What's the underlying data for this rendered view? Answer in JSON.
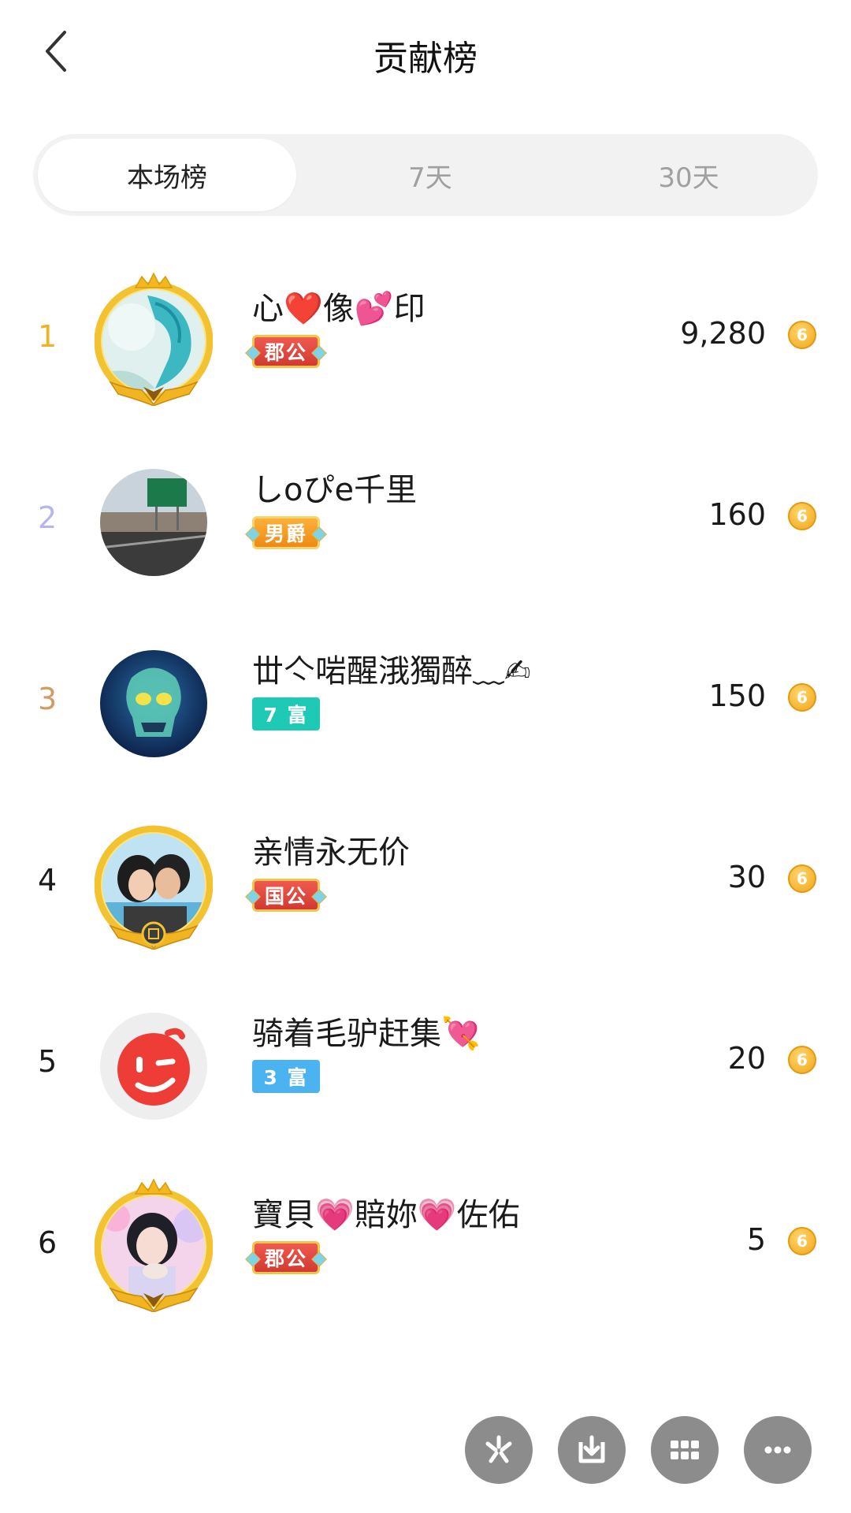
{
  "header": {
    "title": "贡献榜",
    "back_icon": "chevron-left-icon"
  },
  "tabs": [
    {
      "label": "本场榜",
      "active": true
    },
    {
      "label": "7天",
      "active": false
    },
    {
      "label": "30天",
      "active": false
    }
  ],
  "colors": {
    "rank1": "#f0b21e",
    "rank2": "#b7b6ea",
    "rank3": "#d39a63",
    "rank_other": "#1a1a1a",
    "coin": "#f1a61b"
  },
  "ranking": [
    {
      "rank": "1",
      "name": "心❤️像💕印",
      "badge": "郡公",
      "badge_style": "red",
      "score": "9,280",
      "avatar": "dragon-avatar"
    },
    {
      "rank": "2",
      "name": "しoぴe千里",
      "badge": "男爵",
      "badge_style": "orange",
      "score": "160",
      "avatar": "road-sign-avatar"
    },
    {
      "rank": "3",
      "name": "丗亽啱醒涐獨醉﹏✍",
      "badge": "7 富",
      "badge_style": "teal",
      "score": "150",
      "avatar": "skull-avatar"
    },
    {
      "rank": "4",
      "name": "亲情永无价",
      "badge": "国公",
      "badge_style": "red",
      "score": "30",
      "avatar": "couple-avatar"
    },
    {
      "rank": "5",
      "name": "骑着毛驴赶集💘",
      "badge": "3 富",
      "badge_style": "blue",
      "score": "20",
      "avatar": "wink-face-avatar"
    },
    {
      "rank": "6",
      "name": "寶貝💗賠妳💗佐佑",
      "badge": "郡公",
      "badge_style": "red",
      "score": "5",
      "avatar": "girl-avatar"
    }
  ],
  "coin_glyph": "6",
  "bottom_actions": [
    {
      "icon": "spark-icon"
    },
    {
      "icon": "download-icon"
    },
    {
      "icon": "grid-icon"
    },
    {
      "icon": "more-icon"
    }
  ]
}
